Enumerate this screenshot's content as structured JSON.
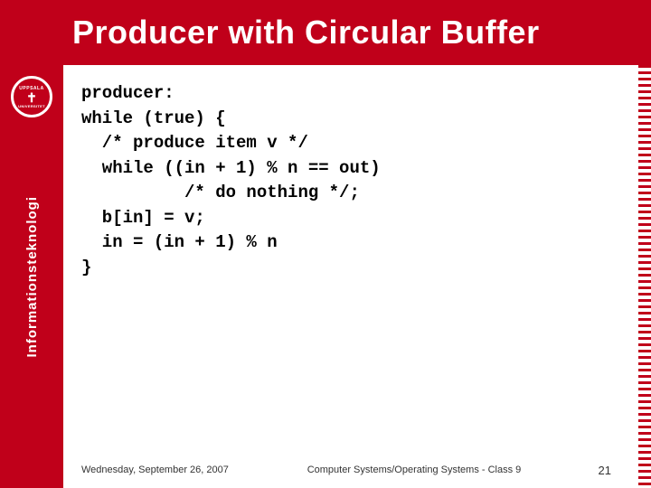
{
  "header": {
    "title": "Producer with Circular Buffer",
    "bg_color": "#c0001a"
  },
  "sidebar": {
    "label": "Informationsteknologi"
  },
  "logo": {
    "top": "UPPSALA",
    "bottom": "UNIVERSITET"
  },
  "code": {
    "lines": [
      "producer:",
      "while (true) {",
      "  /* produce item v */",
      "  while ((in + 1) % n == out)",
      "          /* do nothing */;",
      "  b[in] = v;",
      "  in = (in + 1) % n",
      "}"
    ]
  },
  "footer": {
    "date": "Wednesday, September 26, 2007",
    "course": "Computer Systems/Operating Systems - Class 9",
    "page": "21"
  }
}
